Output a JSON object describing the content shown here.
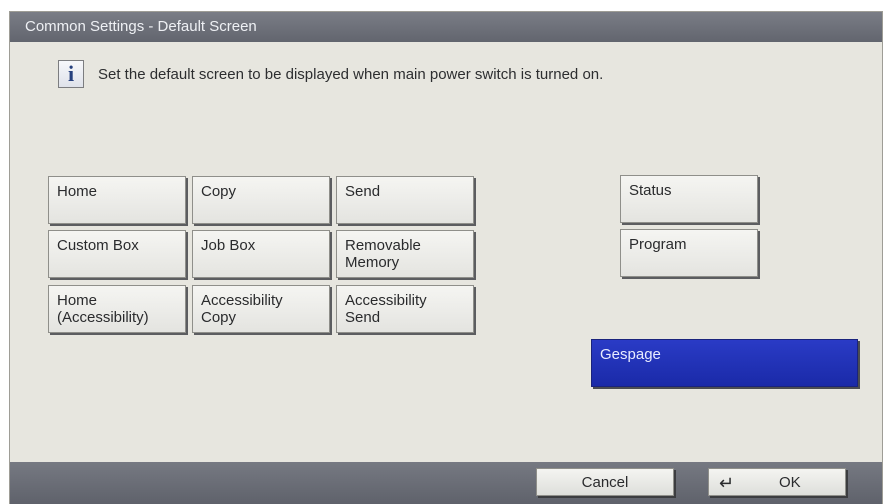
{
  "window": {
    "title": "Common Settings - Default Screen"
  },
  "message": {
    "icon": "info-icon",
    "icon_glyph": "i",
    "text": "Set the default screen to be displayed when main power switch is turned on."
  },
  "options": {
    "home": "Home",
    "copy": "Copy",
    "send": "Send",
    "custom_box": "Custom Box",
    "job_box": "Job Box",
    "removable_memory": "Removable\nMemory",
    "home_accessibility": "Home\n(Accessibility)",
    "accessibility_copy": "Accessibility\nCopy",
    "accessibility_send": "Accessibility\nSend",
    "status": "Status",
    "program": "Program",
    "gespage": "Gespage",
    "selected": "Gespage"
  },
  "footer": {
    "cancel_label": "Cancel",
    "ok_icon": "enter-icon",
    "ok_glyph": "↵",
    "ok_label": "OK"
  },
  "colors": {
    "selected_bg": "#1f30b8",
    "bar_bg": "#6b6e77",
    "panel_bg": "#e7e6df"
  }
}
